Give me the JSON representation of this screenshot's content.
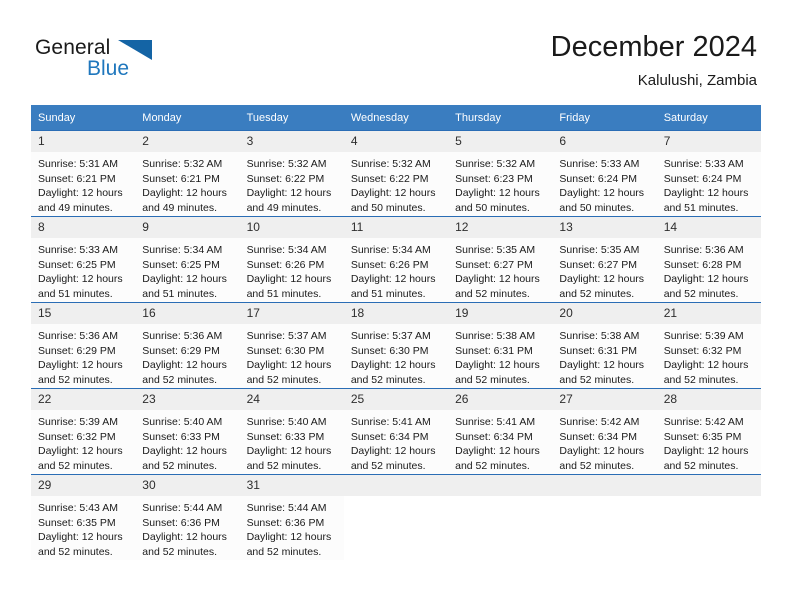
{
  "brand": {
    "name_part1": "General",
    "name_part2": "Blue"
  },
  "header": {
    "title": "December 2024",
    "subtitle": "Kalulushi, Zambia"
  },
  "colors": {
    "header_blue": "#3a7dc0",
    "row_border_blue": "#2a6db5",
    "daynum_band": "#efefef",
    "brand_blue": "#1f77bd"
  },
  "weekdays": [
    "Sunday",
    "Monday",
    "Tuesday",
    "Wednesday",
    "Thursday",
    "Friday",
    "Saturday"
  ],
  "weeks": [
    [
      {
        "day": "1",
        "sunrise": "Sunrise: 5:31 AM",
        "sunset": "Sunset: 6:21 PM",
        "daylight1": "Daylight: 12 hours",
        "daylight2": "and 49 minutes."
      },
      {
        "day": "2",
        "sunrise": "Sunrise: 5:32 AM",
        "sunset": "Sunset: 6:21 PM",
        "daylight1": "Daylight: 12 hours",
        "daylight2": "and 49 minutes."
      },
      {
        "day": "3",
        "sunrise": "Sunrise: 5:32 AM",
        "sunset": "Sunset: 6:22 PM",
        "daylight1": "Daylight: 12 hours",
        "daylight2": "and 49 minutes."
      },
      {
        "day": "4",
        "sunrise": "Sunrise: 5:32 AM",
        "sunset": "Sunset: 6:22 PM",
        "daylight1": "Daylight: 12 hours",
        "daylight2": "and 50 minutes."
      },
      {
        "day": "5",
        "sunrise": "Sunrise: 5:32 AM",
        "sunset": "Sunset: 6:23 PM",
        "daylight1": "Daylight: 12 hours",
        "daylight2": "and 50 minutes."
      },
      {
        "day": "6",
        "sunrise": "Sunrise: 5:33 AM",
        "sunset": "Sunset: 6:24 PM",
        "daylight1": "Daylight: 12 hours",
        "daylight2": "and 50 minutes."
      },
      {
        "day": "7",
        "sunrise": "Sunrise: 5:33 AM",
        "sunset": "Sunset: 6:24 PM",
        "daylight1": "Daylight: 12 hours",
        "daylight2": "and 51 minutes."
      }
    ],
    [
      {
        "day": "8",
        "sunrise": "Sunrise: 5:33 AM",
        "sunset": "Sunset: 6:25 PM",
        "daylight1": "Daylight: 12 hours",
        "daylight2": "and 51 minutes."
      },
      {
        "day": "9",
        "sunrise": "Sunrise: 5:34 AM",
        "sunset": "Sunset: 6:25 PM",
        "daylight1": "Daylight: 12 hours",
        "daylight2": "and 51 minutes."
      },
      {
        "day": "10",
        "sunrise": "Sunrise: 5:34 AM",
        "sunset": "Sunset: 6:26 PM",
        "daylight1": "Daylight: 12 hours",
        "daylight2": "and 51 minutes."
      },
      {
        "day": "11",
        "sunrise": "Sunrise: 5:34 AM",
        "sunset": "Sunset: 6:26 PM",
        "daylight1": "Daylight: 12 hours",
        "daylight2": "and 51 minutes."
      },
      {
        "day": "12",
        "sunrise": "Sunrise: 5:35 AM",
        "sunset": "Sunset: 6:27 PM",
        "daylight1": "Daylight: 12 hours",
        "daylight2": "and 52 minutes."
      },
      {
        "day": "13",
        "sunrise": "Sunrise: 5:35 AM",
        "sunset": "Sunset: 6:27 PM",
        "daylight1": "Daylight: 12 hours",
        "daylight2": "and 52 minutes."
      },
      {
        "day": "14",
        "sunrise": "Sunrise: 5:36 AM",
        "sunset": "Sunset: 6:28 PM",
        "daylight1": "Daylight: 12 hours",
        "daylight2": "and 52 minutes."
      }
    ],
    [
      {
        "day": "15",
        "sunrise": "Sunrise: 5:36 AM",
        "sunset": "Sunset: 6:29 PM",
        "daylight1": "Daylight: 12 hours",
        "daylight2": "and 52 minutes."
      },
      {
        "day": "16",
        "sunrise": "Sunrise: 5:36 AM",
        "sunset": "Sunset: 6:29 PM",
        "daylight1": "Daylight: 12 hours",
        "daylight2": "and 52 minutes."
      },
      {
        "day": "17",
        "sunrise": "Sunrise: 5:37 AM",
        "sunset": "Sunset: 6:30 PM",
        "daylight1": "Daylight: 12 hours",
        "daylight2": "and 52 minutes."
      },
      {
        "day": "18",
        "sunrise": "Sunrise: 5:37 AM",
        "sunset": "Sunset: 6:30 PM",
        "daylight1": "Daylight: 12 hours",
        "daylight2": "and 52 minutes."
      },
      {
        "day": "19",
        "sunrise": "Sunrise: 5:38 AM",
        "sunset": "Sunset: 6:31 PM",
        "daylight1": "Daylight: 12 hours",
        "daylight2": "and 52 minutes."
      },
      {
        "day": "20",
        "sunrise": "Sunrise: 5:38 AM",
        "sunset": "Sunset: 6:31 PM",
        "daylight1": "Daylight: 12 hours",
        "daylight2": "and 52 minutes."
      },
      {
        "day": "21",
        "sunrise": "Sunrise: 5:39 AM",
        "sunset": "Sunset: 6:32 PM",
        "daylight1": "Daylight: 12 hours",
        "daylight2": "and 52 minutes."
      }
    ],
    [
      {
        "day": "22",
        "sunrise": "Sunrise: 5:39 AM",
        "sunset": "Sunset: 6:32 PM",
        "daylight1": "Daylight: 12 hours",
        "daylight2": "and 52 minutes."
      },
      {
        "day": "23",
        "sunrise": "Sunrise: 5:40 AM",
        "sunset": "Sunset: 6:33 PM",
        "daylight1": "Daylight: 12 hours",
        "daylight2": "and 52 minutes."
      },
      {
        "day": "24",
        "sunrise": "Sunrise: 5:40 AM",
        "sunset": "Sunset: 6:33 PM",
        "daylight1": "Daylight: 12 hours",
        "daylight2": "and 52 minutes."
      },
      {
        "day": "25",
        "sunrise": "Sunrise: 5:41 AM",
        "sunset": "Sunset: 6:34 PM",
        "daylight1": "Daylight: 12 hours",
        "daylight2": "and 52 minutes."
      },
      {
        "day": "26",
        "sunrise": "Sunrise: 5:41 AM",
        "sunset": "Sunset: 6:34 PM",
        "daylight1": "Daylight: 12 hours",
        "daylight2": "and 52 minutes."
      },
      {
        "day": "27",
        "sunrise": "Sunrise: 5:42 AM",
        "sunset": "Sunset: 6:34 PM",
        "daylight1": "Daylight: 12 hours",
        "daylight2": "and 52 minutes."
      },
      {
        "day": "28",
        "sunrise": "Sunrise: 5:42 AM",
        "sunset": "Sunset: 6:35 PM",
        "daylight1": "Daylight: 12 hours",
        "daylight2": "and 52 minutes."
      }
    ],
    [
      {
        "day": "29",
        "sunrise": "Sunrise: 5:43 AM",
        "sunset": "Sunset: 6:35 PM",
        "daylight1": "Daylight: 12 hours",
        "daylight2": "and 52 minutes."
      },
      {
        "day": "30",
        "sunrise": "Sunrise: 5:44 AM",
        "sunset": "Sunset: 6:36 PM",
        "daylight1": "Daylight: 12 hours",
        "daylight2": "and 52 minutes."
      },
      {
        "day": "31",
        "sunrise": "Sunrise: 5:44 AM",
        "sunset": "Sunset: 6:36 PM",
        "daylight1": "Daylight: 12 hours",
        "daylight2": "and 52 minutes."
      },
      {
        "day": "",
        "sunrise": "",
        "sunset": "",
        "daylight1": "",
        "daylight2": ""
      },
      {
        "day": "",
        "sunrise": "",
        "sunset": "",
        "daylight1": "",
        "daylight2": ""
      },
      {
        "day": "",
        "sunrise": "",
        "sunset": "",
        "daylight1": "",
        "daylight2": ""
      },
      {
        "day": "",
        "sunrise": "",
        "sunset": "",
        "daylight1": "",
        "daylight2": ""
      }
    ]
  ]
}
